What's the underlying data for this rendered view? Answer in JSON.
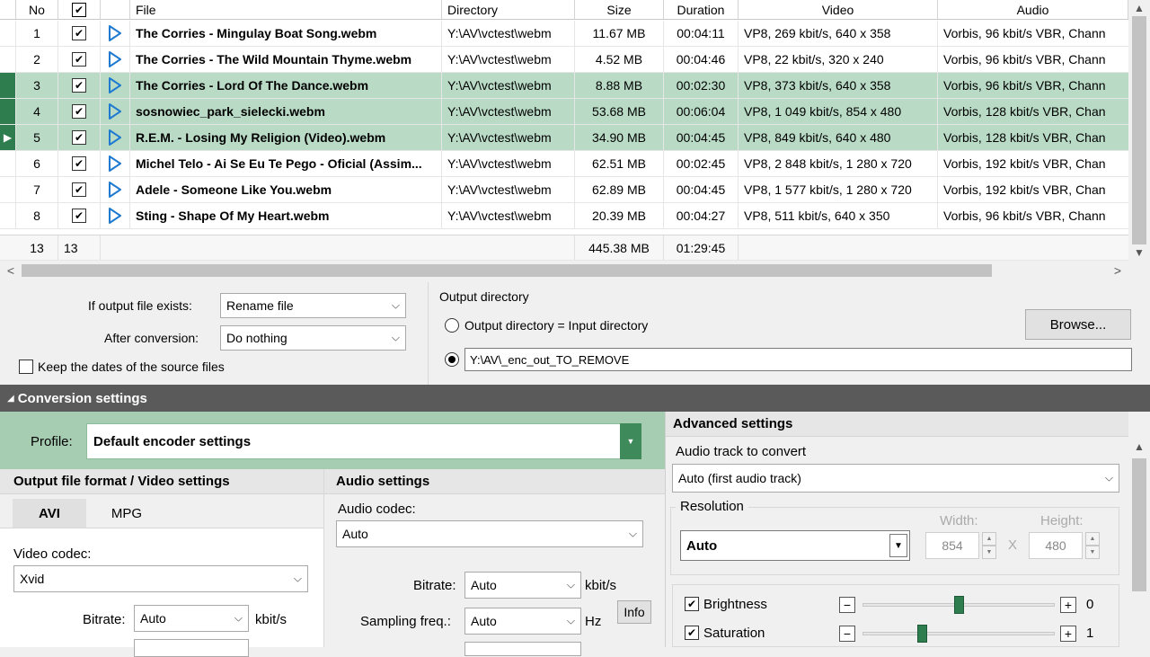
{
  "grid": {
    "columns": {
      "no": "No",
      "file": "File",
      "directory": "Directory",
      "size": "Size",
      "duration": "Duration",
      "video": "Video",
      "audio": "Audio"
    },
    "rows": [
      {
        "no": "1",
        "checked": true,
        "file": "The Corries - Mingulay Boat Song.webm",
        "dir": "Y:\\AV\\vctest\\webm",
        "size": "11.67 MB",
        "duration": "00:04:11",
        "video": "VP8, 269 kbit/s, 640 x 358",
        "audio": "Vorbis, 96 kbit/s VBR, Chann",
        "selected": false,
        "current": false
      },
      {
        "no": "2",
        "checked": true,
        "file": "The Corries - The Wild Mountain Thyme.webm",
        "dir": "Y:\\AV\\vctest\\webm",
        "size": "4.52 MB",
        "duration": "00:04:46",
        "video": "VP8, 22 kbit/s, 320 x 240",
        "audio": "Vorbis, 96 kbit/s VBR, Chann",
        "selected": false,
        "current": false
      },
      {
        "no": "3",
        "checked": true,
        "file": "The Corries - Lord Of The Dance.webm",
        "dir": "Y:\\AV\\vctest\\webm",
        "size": "8.88 MB",
        "duration": "00:02:30",
        "video": "VP8, 373 kbit/s, 640 x 358",
        "audio": "Vorbis, 96 kbit/s VBR, Chann",
        "selected": true,
        "current": false
      },
      {
        "no": "4",
        "checked": true,
        "file": "sosnowiec_park_sielecki.webm",
        "dir": "Y:\\AV\\vctest\\webm",
        "size": "53.68 MB",
        "duration": "00:06:04",
        "video": "VP8, 1 049 kbit/s, 854 x 480",
        "audio": "Vorbis, 128 kbit/s VBR, Chan",
        "selected": true,
        "current": false
      },
      {
        "no": "5",
        "checked": true,
        "file": "R.E.M. - Losing My Religion (Video).webm",
        "dir": "Y:\\AV\\vctest\\webm",
        "size": "34.90 MB",
        "duration": "00:04:45",
        "video": "VP8, 849 kbit/s, 640 x 480",
        "audio": "Vorbis, 128 kbit/s VBR, Chan",
        "selected": true,
        "current": true
      },
      {
        "no": "6",
        "checked": true,
        "file": "Michel Telo - Ai Se Eu Te Pego - Oficial (Assim...",
        "dir": "Y:\\AV\\vctest\\webm",
        "size": "62.51 MB",
        "duration": "00:02:45",
        "video": "VP8, 2 848 kbit/s, 1 280 x 720",
        "audio": "Vorbis, 192 kbit/s VBR, Chan",
        "selected": false,
        "current": false
      },
      {
        "no": "7",
        "checked": true,
        "file": "Adele - Someone Like You.webm",
        "dir": "Y:\\AV\\vctest\\webm",
        "size": "62.89 MB",
        "duration": "00:04:45",
        "video": "VP8, 1 577 kbit/s, 1 280 x 720",
        "audio": "Vorbis, 192 kbit/s VBR, Chan",
        "selected": false,
        "current": false
      },
      {
        "no": "8",
        "checked": true,
        "file": "Sting - Shape Of My Heart.webm",
        "dir": "Y:\\AV\\vctest\\webm",
        "size": "20.39 MB",
        "duration": "00:04:27",
        "video": "VP8, 511 kbit/s, 640 x 350",
        "audio": "Vorbis, 96 kbit/s VBR, Chann",
        "selected": false,
        "current": false
      }
    ],
    "totals": {
      "count": "13",
      "checked": "13",
      "size": "445.38 MB",
      "duration": "01:29:45"
    },
    "icons": {
      "row_play": "play-triangle-icon",
      "current_row": "row-pointer-icon"
    }
  },
  "options": {
    "if_exists_label": "If output file exists:",
    "if_exists_value": "Rename file",
    "after_conv_label": "After conversion:",
    "after_conv_value": "Do nothing",
    "keep_dates_label": "Keep the dates of the source files",
    "keep_dates_checked": false,
    "output_dir_title": "Output directory",
    "radio_same_label": "Output directory = Input directory",
    "radio_same_checked": false,
    "custom_dir_value": "Y:\\AV\\_enc_out_TO_REMOVE",
    "radio_custom_checked": true,
    "browse_label": "Browse..."
  },
  "conversion": {
    "title": "Conversion settings",
    "profile_label": "Profile:",
    "profile_value": "Default encoder settings",
    "output_format": {
      "title": "Output file format / Video settings",
      "tabs": [
        "AVI",
        "MPG"
      ],
      "active_tab": "AVI",
      "video_codec_label": "Video codec:",
      "video_codec_value": "Xvid",
      "bitrate_label": "Bitrate:",
      "bitrate_value": "Auto",
      "bitrate_unit": "kbit/s"
    },
    "audio": {
      "title": "Audio settings",
      "codec_label": "Audio codec:",
      "codec_value": "Auto",
      "bitrate_label": "Bitrate:",
      "bitrate_value": "Auto",
      "bitrate_unit": "kbit/s",
      "sampling_label": "Sampling freq.:",
      "sampling_value": "Auto",
      "sampling_unit": "Hz",
      "info_label": "Info"
    },
    "advanced": {
      "title": "Advanced settings",
      "track_label": "Audio track to convert",
      "track_value": "Auto (first audio track)",
      "resolution_label": "Resolution",
      "resolution_value": "Auto",
      "width_label": "Width:",
      "width_value": "854",
      "height_label": "Height:",
      "height_value": "480",
      "x_sep": "X",
      "brightness_label": "Brightness",
      "brightness_checked": true,
      "brightness_value": "0",
      "brightness_level": 0.5,
      "saturation_label": "Saturation",
      "saturation_checked": true,
      "saturation_value": "1",
      "saturation_level": 0.3
    }
  },
  "colors": {
    "selection": "#b9dbc6",
    "accent": "#2e7d4f",
    "play_icon": "#1e7ad0",
    "header_bar": "#5a5a5a"
  }
}
